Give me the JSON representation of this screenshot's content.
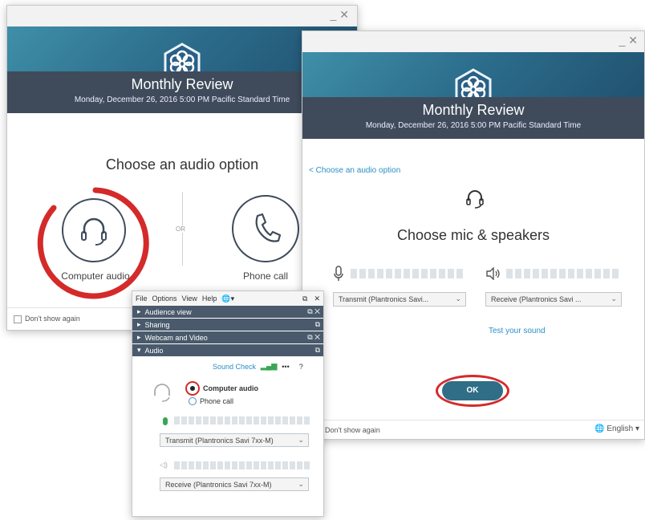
{
  "window1": {
    "win_controls": "_ ✕",
    "title": "Monthly Review",
    "subtitle": "Monday, December 26, 2016   5:00 PM Pacific Standard Time",
    "heading": "Choose an audio option",
    "option_computer": "Computer audio",
    "option_phone": "Phone call",
    "separator": "OR",
    "dont_show": "Don't show again"
  },
  "window2": {
    "win_controls": "_ ✕",
    "title": "Monthly Review",
    "subtitle": "Monday, December 26, 2016   5:00 PM Pacific Standard Time",
    "back_link": "< Choose an audio option",
    "heading": "Choose mic & speakers",
    "transmit_select": "Transmit (Plantronics Savi...",
    "receive_select": "Receive (Plantronics Savi ...",
    "test_sound": "Test your sound",
    "ok_button": "OK",
    "dont_show": "Don't show again",
    "language": "English"
  },
  "panel": {
    "menu": [
      "File",
      "Options",
      "View",
      "Help"
    ],
    "rows": [
      {
        "label": "Audience view",
        "ctl": "⧉ ✕"
      },
      {
        "label": "Sharing",
        "ctl": "⧉"
      },
      {
        "label": "Webcam and Video",
        "ctl": "⧉ ✕"
      },
      {
        "label": "Audio",
        "ctl": "⧉"
      }
    ],
    "sound_check": "Sound Check",
    "more": "•••",
    "help": "?",
    "radio_computer": "Computer audio",
    "radio_phone": "Phone call",
    "transmit_select": "Transmit (Plantronics Savi 7xx-M)",
    "receive_select": "Receive (Plantronics Savi 7xx-M)"
  },
  "colors": {
    "accent_red": "#d42a2a",
    "banner_dark": "#3f4b5b",
    "link_blue": "#2b8fc4",
    "ok_button": "#2f6e86",
    "icon_border": "#3f4b5b"
  }
}
